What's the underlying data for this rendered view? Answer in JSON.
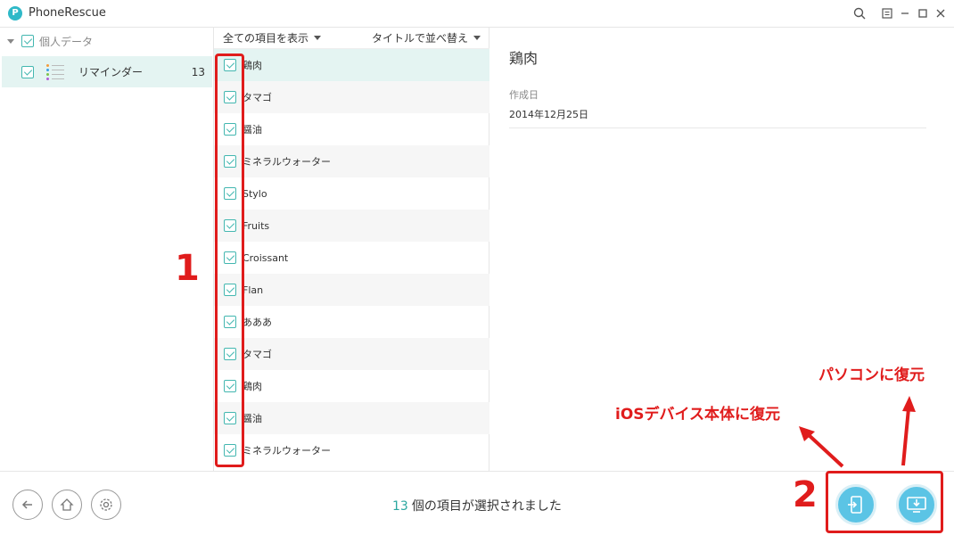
{
  "window": {
    "title": "PhoneRescue"
  },
  "sidebar": {
    "category": "個人データ",
    "reminders": {
      "label": "リマインダー",
      "count": "13"
    }
  },
  "list": {
    "filter_label": "全ての項目を表示",
    "sort_label": "タイトルで並べ替え",
    "items": [
      "鶏肉",
      "タマゴ",
      "醤油",
      "ミネラルウォーター",
      "Stylo",
      "Fruits",
      "Croissant",
      "Flan",
      "あああ",
      "タマゴ",
      "鶏肉",
      "醤油",
      "ミネラルウォーター"
    ]
  },
  "detail": {
    "title": "鶏肉",
    "created_label": "作成日",
    "created_value": "2014年12月25日"
  },
  "status": {
    "count": "13",
    "text": "個の項目が選択されました"
  },
  "annotations": {
    "step1": "1",
    "step2": "2",
    "ios_label": "iOSデバイス本体に復元",
    "pc_label": "パソコンに復元"
  },
  "colors": {
    "accent": "#43b7b0",
    "selection": "#e4f4f2",
    "action_button": "#5bc4e5",
    "annotation": "#e01c1c"
  }
}
